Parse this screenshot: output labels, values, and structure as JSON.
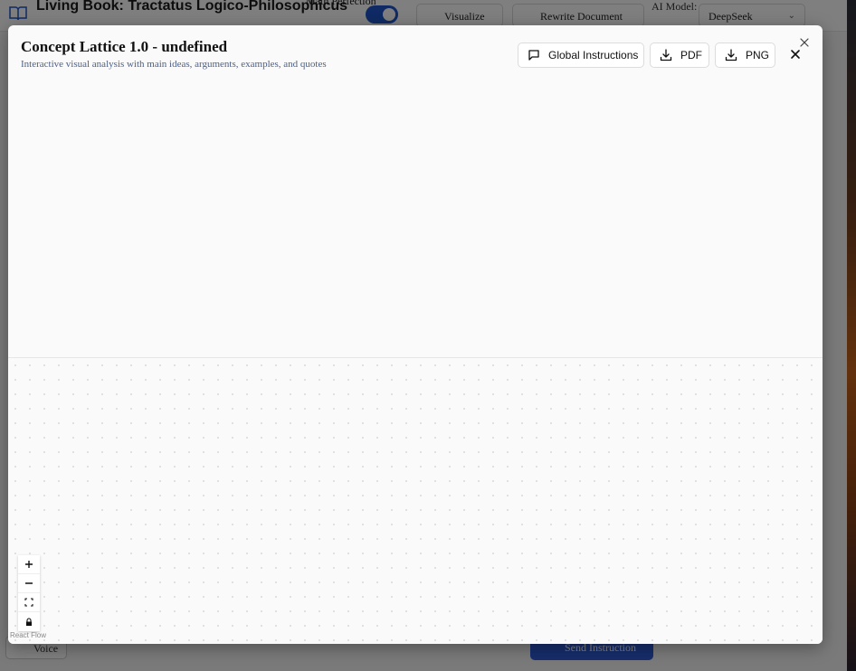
{
  "app": {
    "title": "Living Book: Tractatus Logico-Philosophicus",
    "math_toggle_label": "Math Perfection",
    "math_toggle_on": true,
    "visualize_label": "Visualize",
    "rewrite_label": "Rewrite Document",
    "ai_model_label": "AI Model:",
    "ai_model_value": "DeepSeek",
    "voice_label": "Voice",
    "send_label": "Send Instruction"
  },
  "modal": {
    "title": "Concept Lattice 1.0 - undefined",
    "subtitle": "Interactive visual analysis with main ideas, arguments, examples, and quotes",
    "toolbar": {
      "global_instructions_label": "Global Instructions",
      "pdf_label": "PDF",
      "png_label": "PNG"
    },
    "icons": {
      "global_instructions": "message-square-icon",
      "pdf": "download-icon",
      "png": "download-icon",
      "close": "close-icon"
    },
    "flow": {
      "controls": [
        "zoom-in",
        "zoom-out",
        "fit-view",
        "lock"
      ],
      "attribution": "React Flow"
    }
  }
}
